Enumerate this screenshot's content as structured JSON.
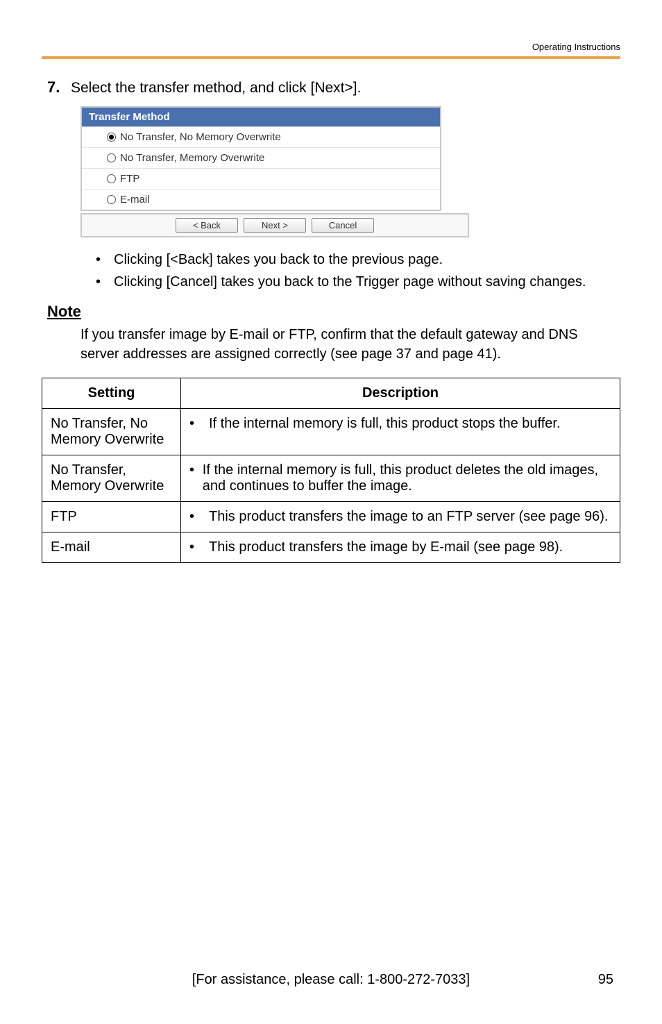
{
  "header": {
    "section": "Operating Instructions"
  },
  "step": {
    "num": "7.",
    "text": "Select the transfer method, and click [Next>]."
  },
  "transfer_method": {
    "title": "Transfer Method",
    "options": [
      {
        "label": "No Transfer, No Memory Overwrite",
        "selected": true
      },
      {
        "label": "No Transfer, Memory Overwrite",
        "selected": false
      },
      {
        "label": "FTP",
        "selected": false
      },
      {
        "label": "E-mail",
        "selected": false
      }
    ],
    "buttons": {
      "back": "< Back",
      "next": "Next >",
      "cancel": "Cancel"
    }
  },
  "bullets": [
    "Clicking [<Back] takes you back to the previous page.",
    "Clicking [Cancel] takes you back to the Trigger page without saving changes."
  ],
  "note": {
    "heading": "Note",
    "body": "If you transfer image by E-mail or FTP, confirm that the default gateway and DNS server addresses are assigned correctly (see page 37 and page 41)."
  },
  "table": {
    "headers": {
      "setting": "Setting",
      "description": "Description"
    },
    "rows": [
      {
        "setting": "No Transfer, No Memory Overwrite",
        "desc": "If the internal memory is full, this product stops the buffer."
      },
      {
        "setting": "No Transfer, Memory Overwrite",
        "desc": "If the internal memory is full, this product deletes the old images, and continues to buffer the image."
      },
      {
        "setting": "FTP",
        "desc": "This product transfers the image to an FTP server (see page 96)."
      },
      {
        "setting": "E-mail",
        "desc": "This product transfers the image by E-mail (see page 98)."
      }
    ]
  },
  "footer": {
    "assist": "[For assistance, please call: 1-800-272-7033]",
    "page": "95"
  }
}
